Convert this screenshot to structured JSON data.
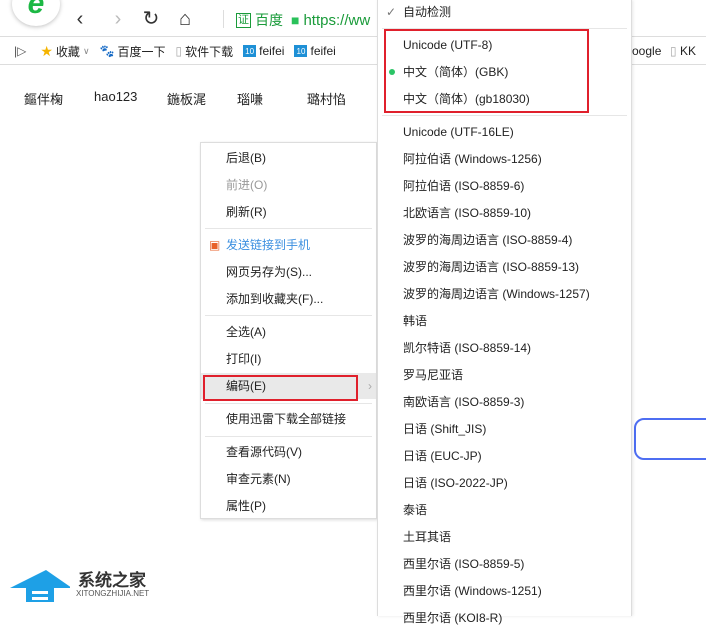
{
  "toolbar": {
    "logo": "e",
    "back": "‹",
    "forward": "›",
    "reload": "↻",
    "home": "⌂",
    "cert": "证",
    "site": "百度",
    "url": "https://ww"
  },
  "bookmarks": [
    {
      "label": "收藏",
      "icon": "star-icon"
    },
    {
      "label": "百度一下",
      "icon": "paw-icon"
    },
    {
      "label": "软件下载",
      "icon": "page-icon"
    },
    {
      "label": "feifei",
      "icon": "win10-icon"
    },
    {
      "label": "feifei",
      "icon": "win10-icon"
    },
    {
      "label": "oogle",
      "icon": ""
    },
    {
      "label": "KK",
      "icon": "page-icon"
    }
  ],
  "win10": "10",
  "page_links": [
    "鏂伴椈",
    "hao123",
    "鍦板浘",
    "瑙嗛",
    "璐村惂"
  ],
  "context_menu": [
    "后退(B)",
    "前进(O)",
    "刷新(R)",
    "发送链接到手机",
    "网页另存为(S)...",
    "添加到收藏夹(F)...",
    "全选(A)",
    "打印(I)",
    "编码(E)",
    "使用迅雷下载全部链接",
    "查看源代码(V)",
    "审查元素(N)",
    "属性(P)"
  ],
  "encoding_menu": {
    "auto": "自动检测",
    "items": [
      "Unicode (UTF-8)",
      "中文（简体）(GBK)",
      "中文（简体）(gb18030)",
      "Unicode (UTF-16LE)",
      "阿拉伯语 (Windows-1256)",
      "阿拉伯语 (ISO-8859-6)",
      "北欧语言 (ISO-8859-10)",
      "波罗的海周边语言 (ISO-8859-4)",
      "波罗的海周边语言 (ISO-8859-13)",
      "波罗的海周边语言 (Windows-1257)",
      "韩语",
      "凯尔特语 (ISO-8859-14)",
      "罗马尼亚语",
      "南欧语言 (ISO-8859-3)",
      "日语 (Shift_JIS)",
      "日语 (EUC-JP)",
      "日语 (ISO-2022-JP)",
      "泰语",
      "土耳其语",
      "西里尔语 (ISO-8859-5)",
      "西里尔语 (Windows-1251)",
      "西里尔语 (KOI8-R)"
    ],
    "selected": "中文（简体）(GBK)"
  },
  "watermark": {
    "title": "系统之家",
    "sub": "XITONGZHIJIA.NET"
  }
}
